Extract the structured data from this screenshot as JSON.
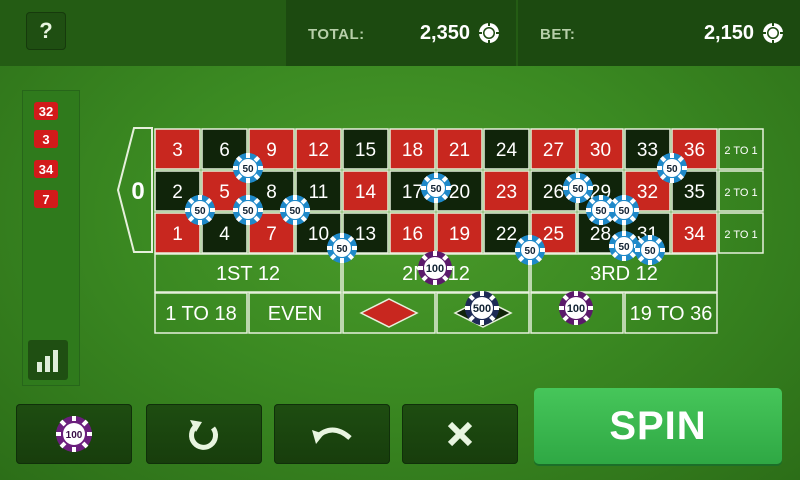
{
  "header": {
    "help_label": "?",
    "total_label": "TOTAL:",
    "total_value": "2,350",
    "bet_label": "BET:",
    "bet_value": "2,150"
  },
  "history": [
    "32",
    "3",
    "34",
    "7"
  ],
  "table": {
    "zero": "0",
    "rows": [
      [
        "3",
        "6",
        "9",
        "12",
        "15",
        "18",
        "21",
        "24",
        "27",
        "30",
        "33",
        "36"
      ],
      [
        "2",
        "5",
        "8",
        "11",
        "14",
        "17",
        "20",
        "23",
        "26",
        "29",
        "32",
        "35"
      ],
      [
        "1",
        "4",
        "7",
        "10",
        "13",
        "16",
        "19",
        "22",
        "25",
        "28",
        "31",
        "34"
      ]
    ],
    "red_numbers": [
      "1",
      "3",
      "5",
      "7",
      "9",
      "12",
      "14",
      "16",
      "18",
      "19",
      "21",
      "23",
      "25",
      "27",
      "30",
      "32",
      "34",
      "36"
    ],
    "column_bets": [
      "2 TO 1",
      "2 TO 1",
      "2 TO 1"
    ],
    "dozens": [
      "1ST 12",
      "2ND 12",
      "3RD 12"
    ],
    "outside": [
      "1 TO 18",
      "EVEN",
      "",
      "",
      "",
      "19 TO 36"
    ]
  },
  "chips_on_table": [
    "50",
    "50",
    "50",
    "50",
    "50",
    "50",
    "50",
    "50",
    "50",
    "50",
    "50",
    "50",
    "50",
    "50",
    "100",
    "500",
    "100"
  ],
  "selected_chip": "100",
  "spin_label": "SPIN",
  "colors": {
    "red": "#c8271f",
    "black": "#10240a",
    "felt": "#3b8a22",
    "spin_green": "#3cb851"
  }
}
